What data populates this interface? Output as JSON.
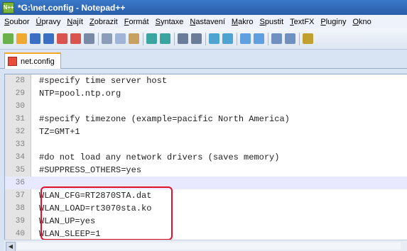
{
  "window": {
    "app_icon_label": "N++",
    "title": "*G:\\net.config - Notepad++"
  },
  "menu": [
    {
      "ul": "S",
      "rest": "oubor"
    },
    {
      "ul": "Ú",
      "rest": "pravy"
    },
    {
      "ul": "N",
      "rest": "ajít"
    },
    {
      "ul": "Z",
      "rest": "obrazit"
    },
    {
      "ul": "F",
      "rest": "ormát"
    },
    {
      "ul": "S",
      "rest": "yntaxe"
    },
    {
      "ul": "N",
      "rest": "astavení"
    },
    {
      "ul": "M",
      "rest": "akro"
    },
    {
      "ul": "S",
      "rest": "pustit"
    },
    {
      "ul": "T",
      "rest": "extFX"
    },
    {
      "ul": "P",
      "rest": "luginy"
    },
    {
      "ul": "O",
      "rest": "kno"
    }
  ],
  "toolbar_icons": [
    {
      "name": "new-file-icon",
      "color": "#6ab04c"
    },
    {
      "name": "open-file-icon",
      "color": "#f0a830"
    },
    {
      "name": "save-icon",
      "color": "#3b6fc4"
    },
    {
      "name": "save-all-icon",
      "color": "#3b6fc4"
    },
    {
      "name": "close-icon",
      "color": "#d9534f"
    },
    {
      "name": "close-all-icon",
      "color": "#d9534f"
    },
    {
      "name": "print-icon",
      "color": "#7a8aa6"
    },
    {
      "name": "cut-icon",
      "color": "#8b9cb8"
    },
    {
      "name": "copy-icon",
      "color": "#9fb4d6"
    },
    {
      "name": "paste-icon",
      "color": "#c8a060"
    },
    {
      "name": "undo-icon",
      "color": "#3aa5a0"
    },
    {
      "name": "redo-icon",
      "color": "#3aa5a0"
    },
    {
      "name": "find-icon",
      "color": "#6b7c99"
    },
    {
      "name": "replace-icon",
      "color": "#6b7c99"
    },
    {
      "name": "zoom-in-icon",
      "color": "#4fa3d1"
    },
    {
      "name": "zoom-out-icon",
      "color": "#4fa3d1"
    },
    {
      "name": "sync-vertical-icon",
      "color": "#5f9fe0"
    },
    {
      "name": "sync-horizontal-icon",
      "color": "#5f9fe0"
    },
    {
      "name": "word-wrap-icon",
      "color": "#7090c0"
    },
    {
      "name": "show-all-chars-icon",
      "color": "#7090c0"
    },
    {
      "name": "indent-guide-icon",
      "color": "#c0a030"
    }
  ],
  "tab": {
    "label": "net.config",
    "icon": "file-modified-icon"
  },
  "lines": [
    {
      "num": "28",
      "text": "#specify time server host"
    },
    {
      "num": "29",
      "text": "NTP=pool.ntp.org"
    },
    {
      "num": "30",
      "text": ""
    },
    {
      "num": "31",
      "text": "#specify timezone (example=pacific North America)"
    },
    {
      "num": "32",
      "text": "TZ=GMT+1"
    },
    {
      "num": "33",
      "text": ""
    },
    {
      "num": "34",
      "text": "#do not load any network drivers (saves memory)"
    },
    {
      "num": "35",
      "text": "#SUPPRESS_OTHERS=yes"
    },
    {
      "num": "36",
      "text": ""
    },
    {
      "num": "37",
      "text": "WLAN_CFG=RT2870STA.dat"
    },
    {
      "num": "38",
      "text": "WLAN_LOAD=rt3070sta.ko"
    },
    {
      "num": "39",
      "text": "WLAN_UP=yes"
    },
    {
      "num": "40",
      "text": "WLAN_SLEEP=1"
    }
  ],
  "current_line": "36",
  "highlight_color": "#e3102b"
}
